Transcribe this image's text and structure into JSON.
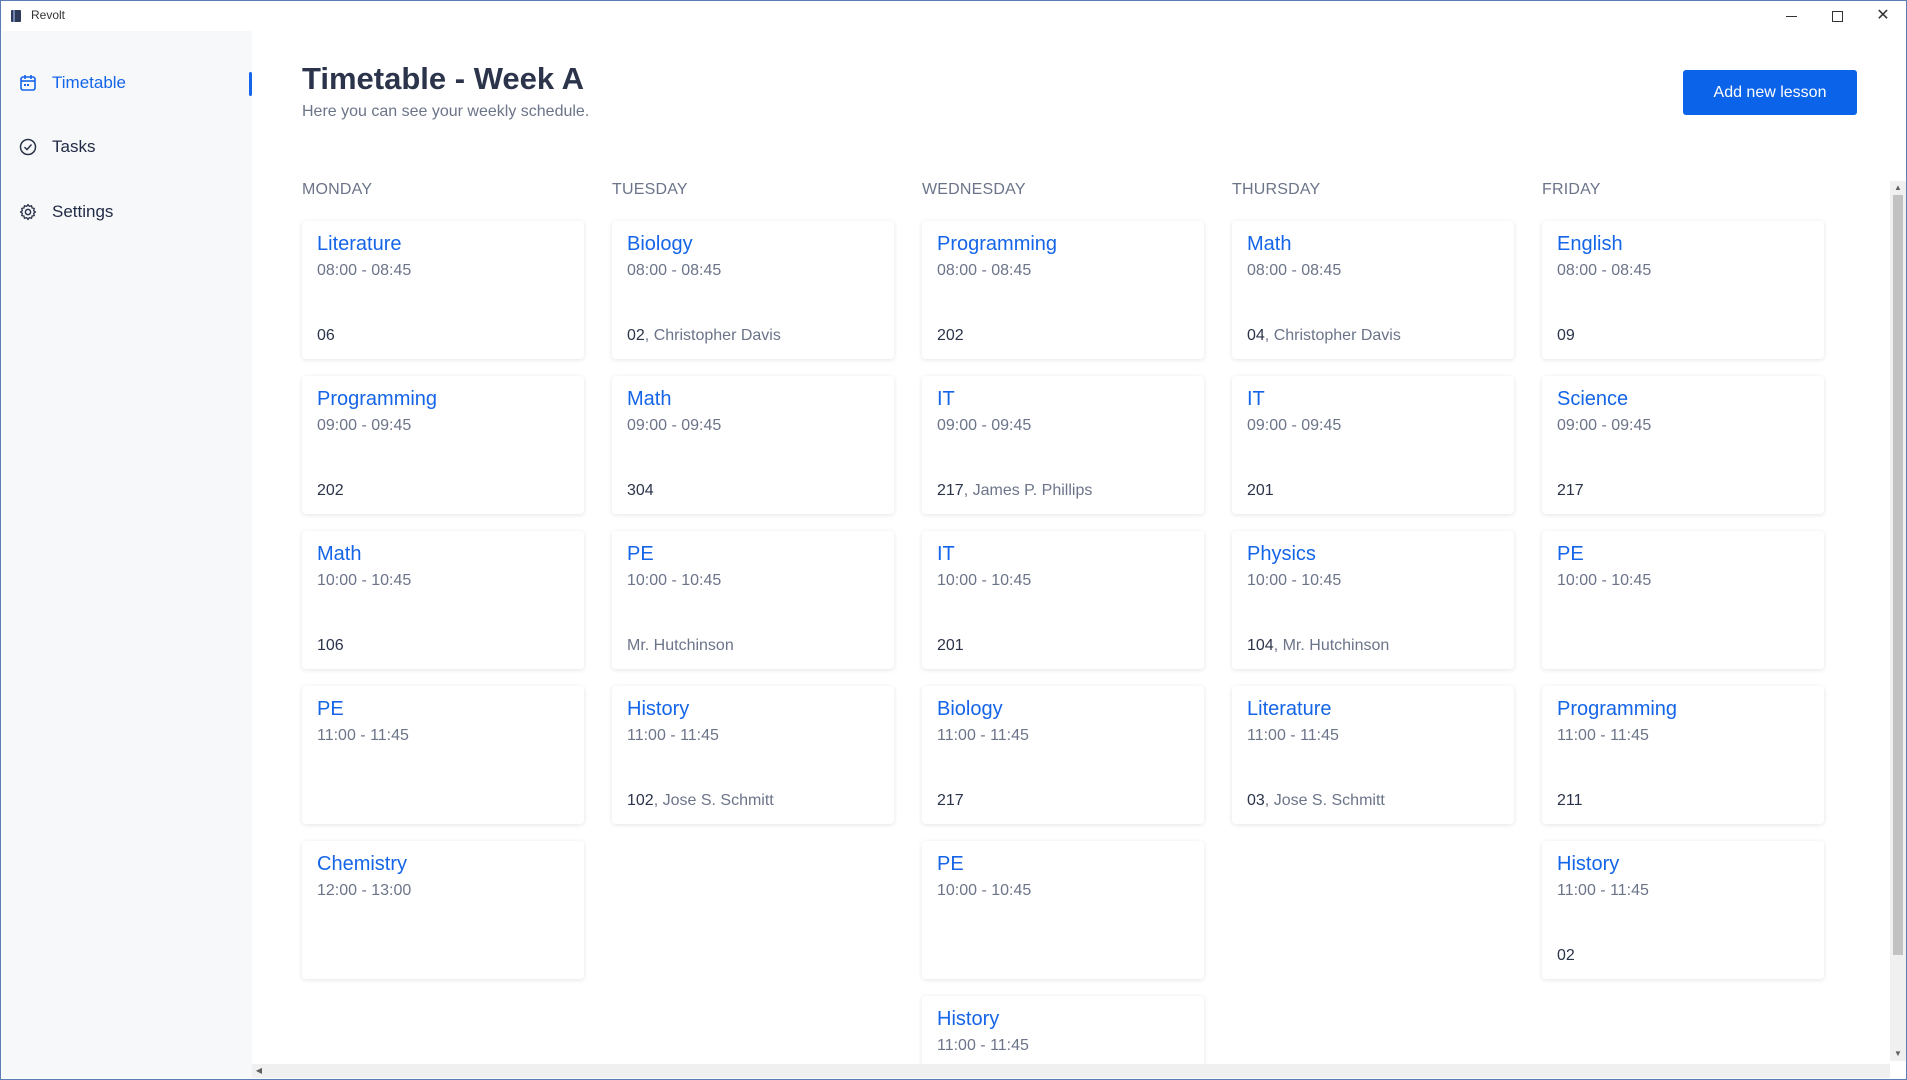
{
  "window": {
    "title": "Revolt"
  },
  "sidebar": {
    "items": [
      {
        "label": "Timetable",
        "icon": "calendar-icon",
        "active": true
      },
      {
        "label": "Tasks",
        "icon": "check-circle-icon",
        "active": false
      },
      {
        "label": "Settings",
        "icon": "gear-icon",
        "active": false
      }
    ]
  },
  "header": {
    "title": "Timetable - Week A",
    "subtitle": "Here you can see your weekly schedule.",
    "add_button": "Add new lesson"
  },
  "colors": {
    "accent": "#1565e8",
    "button": "#0a63e8",
    "muted": "#6b7489",
    "heading": "#2b344a"
  },
  "days": [
    {
      "name": "MONDAY",
      "lessons": [
        {
          "subject": "Literature",
          "time": "08:00 - 08:45",
          "room": "06",
          "teacher": ""
        },
        {
          "subject": "Programming",
          "time": "09:00 - 09:45",
          "room": "202",
          "teacher": ""
        },
        {
          "subject": "Math",
          "time": "10:00 - 10:45",
          "room": "106",
          "teacher": ""
        },
        {
          "subject": "PE",
          "time": "11:00 - 11:45",
          "room": "",
          "teacher": ""
        },
        {
          "subject": "Chemistry",
          "time": "12:00 - 13:00",
          "room": "",
          "teacher": ""
        }
      ]
    },
    {
      "name": "TUESDAY",
      "lessons": [
        {
          "subject": "Biology",
          "time": "08:00 - 08:45",
          "room": "02",
          "teacher": "Christopher Davis"
        },
        {
          "subject": "Math",
          "time": "09:00 - 09:45",
          "room": "304",
          "teacher": ""
        },
        {
          "subject": "PE",
          "time": "10:00 - 10:45",
          "room": "",
          "teacher": "Mr. Hutchinson"
        },
        {
          "subject": "History",
          "time": "11:00 - 11:45",
          "room": "102",
          "teacher": "Jose S. Schmitt"
        }
      ]
    },
    {
      "name": "WEDNESDAY",
      "lessons": [
        {
          "subject": "Programming",
          "time": "08:00 - 08:45",
          "room": "202",
          "teacher": ""
        },
        {
          "subject": "IT",
          "time": "09:00 - 09:45",
          "room": "217",
          "teacher": "James P. Phillips"
        },
        {
          "subject": "IT",
          "time": "10:00 - 10:45",
          "room": "201",
          "teacher": ""
        },
        {
          "subject": "Biology",
          "time": "11:00 - 11:45",
          "room": "217",
          "teacher": ""
        },
        {
          "subject": "PE",
          "time": "10:00 - 10:45",
          "room": "",
          "teacher": ""
        },
        {
          "subject": "History",
          "time": "11:00 - 11:45",
          "room": "",
          "teacher": ""
        }
      ]
    },
    {
      "name": "THURSDAY",
      "lessons": [
        {
          "subject": "Math",
          "time": "08:00 - 08:45",
          "room": "04",
          "teacher": "Christopher Davis"
        },
        {
          "subject": "IT",
          "time": "09:00 - 09:45",
          "room": "201",
          "teacher": ""
        },
        {
          "subject": "Physics",
          "time": "10:00 - 10:45",
          "room": "104",
          "teacher": "Mr. Hutchinson"
        },
        {
          "subject": "Literature",
          "time": "11:00 - 11:45",
          "room": "03",
          "teacher": "Jose S. Schmitt"
        }
      ]
    },
    {
      "name": "FRIDAY",
      "lessons": [
        {
          "subject": "English",
          "time": "08:00 - 08:45",
          "room": "09",
          "teacher": ""
        },
        {
          "subject": "Science",
          "time": "09:00 - 09:45",
          "room": "217",
          "teacher": ""
        },
        {
          "subject": "PE",
          "time": "10:00 - 10:45",
          "room": "",
          "teacher": ""
        },
        {
          "subject": "Programming",
          "time": "11:00 - 11:45",
          "room": "211",
          "teacher": ""
        },
        {
          "subject": "History",
          "time": "11:00 - 11:45",
          "room": "02",
          "teacher": ""
        }
      ]
    }
  ]
}
